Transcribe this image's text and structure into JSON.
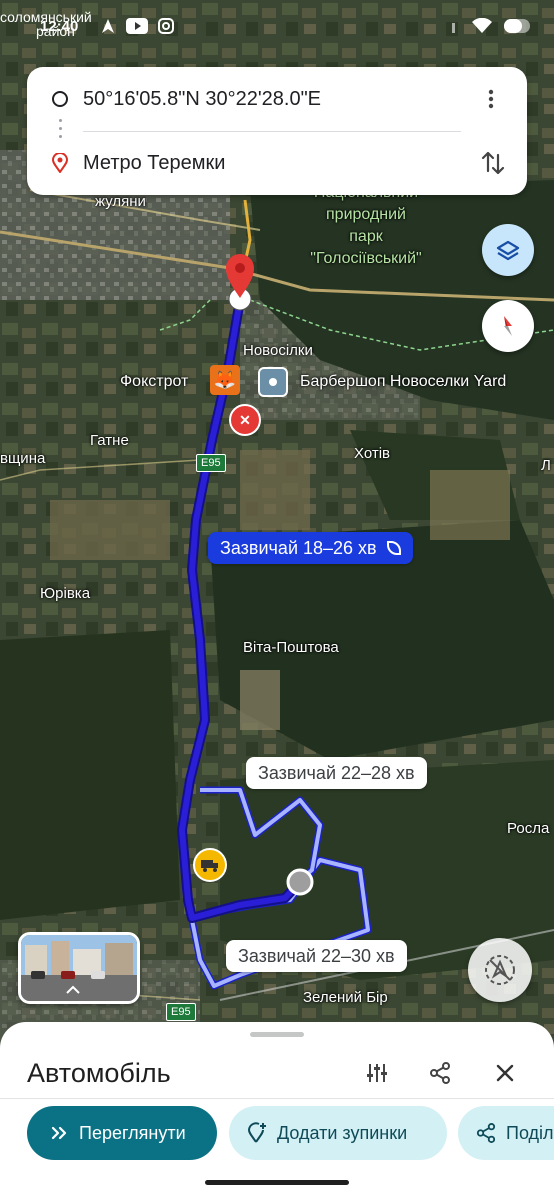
{
  "status_bar": {
    "time": "12:40",
    "overlay_text_1": "соломянський",
    "overlay_text_2": "район"
  },
  "search": {
    "origin": "50°16'05.8\"N 30°22'28.0\"E",
    "destination": "Метро Теремки"
  },
  "map": {
    "labels": {
      "zhuliany": "жуляни",
      "park": "Національний природний парк \"Голосіївський\"",
      "park_line1": "Національний",
      "park_line2": "природний",
      "park_line3": "парк",
      "park_line4": "\"Голосіївський\"",
      "novosilky": "Новосілки",
      "foxtrot": "Фокстрот",
      "barbershop": "Барбершоп Новоселки Yard",
      "hatne": "Гатне",
      "khotiv": "Хотів",
      "vshchyna": "вщина",
      "l_edge": "Л",
      "e95_top": "E95",
      "e95_bottom": "E95",
      "yurivka": "Юрівка",
      "vita_poshtova": "Віта-Поштова",
      "rosla": "Росла",
      "zelenyi_bir": "Зелений Бір"
    },
    "routes": {
      "primary": "Зазвичай 18–26 хв",
      "alt1": "Зазвичай 22–28 хв",
      "alt2": "Зазвичай 22–30 хв"
    }
  },
  "sheet": {
    "title": "Автомобіль",
    "preview_button": "Переглянути",
    "add_stops_button": "Додати зупинки",
    "share_button": "Поділ"
  },
  "colors": {
    "route_primary": "#2a1fd6",
    "route_alt": "#a8b4ff",
    "accent_teal": "#0b7285",
    "pin_red": "#e53935"
  },
  "icons": {
    "more": "more-vert-icon",
    "swap": "swap-vert-icon",
    "layers": "layers-icon",
    "compass": "compass-icon",
    "filters": "tune-icon",
    "share": "share-icon",
    "close": "close-icon",
    "preview": "chevrons-right-icon",
    "add_stop": "add-location-icon"
  }
}
